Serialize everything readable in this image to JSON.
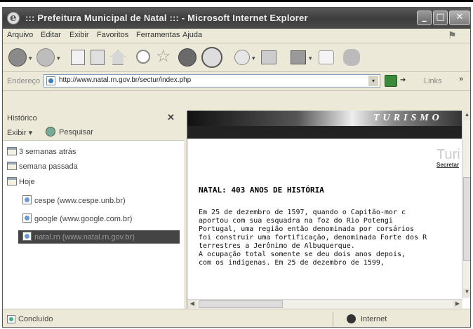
{
  "window": {
    "title": "::: Prefeitura Municipal de Natal ::: - Microsoft Internet Explorer",
    "controls": {
      "minimize": "_",
      "maximize": "□",
      "close": "✕"
    }
  },
  "menu": [
    "Arquivo",
    "Editar",
    "Exibir",
    "Favoritos",
    "Ferramentas",
    "Ajuda"
  ],
  "toolbar": {
    "icons": [
      "back-icon",
      "forward-icon",
      "stop-icon",
      "refresh-icon",
      "home-icon",
      "search-icon",
      "favorites-icon",
      "media-icon",
      "history-icon",
      "mail-icon",
      "print-icon",
      "edit-icon",
      "discuss-icon",
      "messenger-icon"
    ],
    "dropdown": "▾"
  },
  "address": {
    "label": "Endereço",
    "url": "http://www.natal.rn.gov.br/sectur/index.php",
    "go_arrow": "➔",
    "links_label": "Links",
    "more": "»"
  },
  "history": {
    "title": "Histórico",
    "close": "✕",
    "view_label": "Exibir",
    "search_label": "Pesquisar",
    "items": [
      {
        "label": "3 semanas atrás",
        "kind": "calendar"
      },
      {
        "label": "semana passada",
        "kind": "calendar"
      },
      {
        "label": "Hoje",
        "kind": "calendar"
      },
      {
        "label": "cespe (www.cespe.unb.br)",
        "kind": "page"
      },
      {
        "label": "google (www.google.com.br)",
        "kind": "page"
      },
      {
        "label": "natal.rn (www.natal.rn.gov.br)",
        "kind": "page",
        "selected": true
      }
    ]
  },
  "page": {
    "banner_text": "TURISMO",
    "brand_partial": "Turi",
    "brand_sub": "Secretar",
    "heading": "NATAL: 403 ANOS DE HISTÓRIA",
    "paragraph_lines": [
      "Em 25 de dezembro de 1597, quando o Capitão-mor c",
      "aportou com sua esquadra na foz do Rio Potengi",
      "Portugal, uma região então denominada por corsários",
      "foi construir uma fortificação, denominada Forte dos R",
      "terrestres a Jerônimo de Albuquerque.",
      "A ocupação total somente se deu dois anos depois,",
      "com os indígenas. Em 25 de dezembro de 1599,"
    ]
  },
  "status": {
    "text": "Concluído",
    "zone": "Internet"
  }
}
